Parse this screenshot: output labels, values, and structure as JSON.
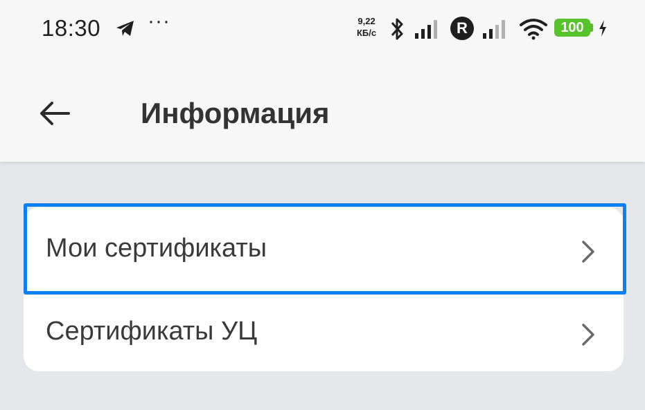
{
  "status_bar": {
    "time": "18:30",
    "speed_value": "9,22",
    "speed_unit": "КБ/с",
    "roaming_badge": "R",
    "battery_level": "100",
    "icons": [
      "telegram-icon",
      "more-dots",
      "bluetooth-icon",
      "signal-icon",
      "roaming-icon",
      "signal-icon",
      "wifi-icon",
      "battery-icon",
      "charging-bolt-icon"
    ]
  },
  "header": {
    "back_icon": "arrow-left-icon",
    "title": "Информация"
  },
  "menu": {
    "items": [
      {
        "label": "Мои сертификаты",
        "icon": "chevron-right-icon",
        "highlighted": true
      },
      {
        "label": "Сертификаты УЦ",
        "icon": "chevron-right-icon",
        "highlighted": false
      }
    ]
  },
  "colors": {
    "highlight_border": "#0c7ff2",
    "battery": "#58c22c",
    "background": "#e6e7ea"
  }
}
